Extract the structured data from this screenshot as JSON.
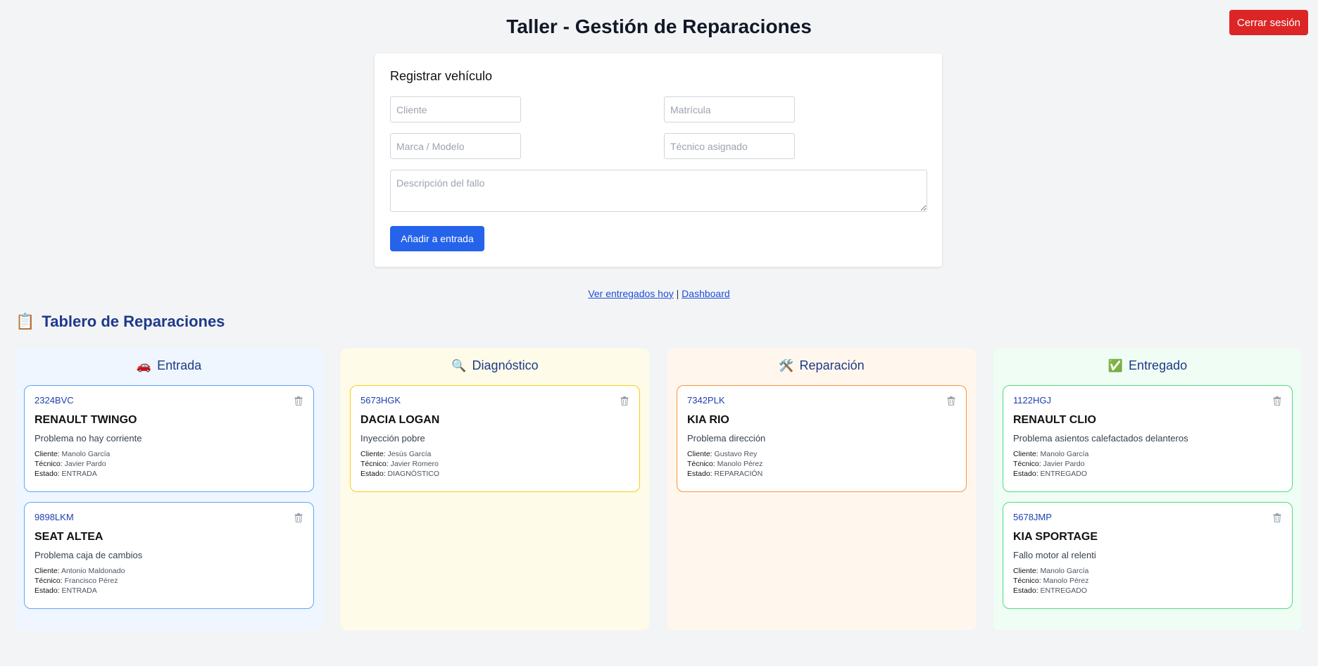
{
  "header": {
    "title": "Taller - Gestión de Reparaciones",
    "logout_label": "Cerrar sesión"
  },
  "form": {
    "title": "Registrar vehículo",
    "cliente_placeholder": "Cliente",
    "matricula_placeholder": "Matrícula",
    "marca_placeholder": "Marca / Modelo",
    "tecnico_placeholder": "Técnico asignado",
    "descripcion_placeholder": "Descripción del fallo",
    "submit_label": "Añadir a entrada"
  },
  "links": {
    "entregados": "Ver entregados hoy",
    "separator": "|",
    "dashboard": "Dashboard"
  },
  "board": {
    "emoji": "📋",
    "title": "Tablero de Reparaciones",
    "labels": {
      "cliente": "Cliente:",
      "tecnico": "Técnico:",
      "estado": "Estado:"
    },
    "columns": [
      {
        "emoji": "🚗",
        "title": "Entrada",
        "bg": "#eff6ff",
        "border": "#60a5fa",
        "cards": [
          {
            "plate": "2324BVC",
            "model": "RENAULT TWINGO",
            "desc": "Problema no hay corriente",
            "cliente": "Manolo García",
            "tecnico": "Javier Pardo",
            "estado": "ENTRADA"
          },
          {
            "plate": "9898LKM",
            "model": "SEAT ALTEA",
            "desc": "Problema caja de cambios",
            "cliente": "Antonio Maldonado",
            "tecnico": "Francisco Pérez",
            "estado": "ENTRADA"
          }
        ]
      },
      {
        "emoji": "🔍",
        "title": "Diagnóstico",
        "bg": "#fefce8",
        "border": "#facc15",
        "cards": [
          {
            "plate": "5673HGK",
            "model": "DACIA LOGAN",
            "desc": "Inyección pobre",
            "cliente": "Jesús García",
            "tecnico": "Javier Romero",
            "estado": "DIAGNÓSTICO"
          }
        ]
      },
      {
        "emoji": "🛠️",
        "title": "Reparación",
        "bg": "#fff7ed",
        "border": "#fb923c",
        "cards": [
          {
            "plate": "7342PLK",
            "model": "KIA RIO",
            "desc": "Problema dirección",
            "cliente": "Gustavo Rey",
            "tecnico": "Manolo Pérez",
            "estado": "REPARACIÓN"
          }
        ]
      },
      {
        "emoji": "✅",
        "title": "Entregado",
        "bg": "#f0fdf4",
        "border": "#4ade80",
        "cards": [
          {
            "plate": "1122HGJ",
            "model": "RENAULT CLIO",
            "desc": "Problema asientos calefactados delanteros",
            "cliente": "Manolo García",
            "tecnico": "Javier Pardo",
            "estado": "ENTREGADO"
          },
          {
            "plate": "5678JMP",
            "model": "KIA SPORTAGE",
            "desc": "Fallo motor al relenti",
            "cliente": "Manolo García",
            "tecnico": "Manolo Pérez",
            "estado": "ENTREGADO"
          }
        ]
      }
    ]
  }
}
